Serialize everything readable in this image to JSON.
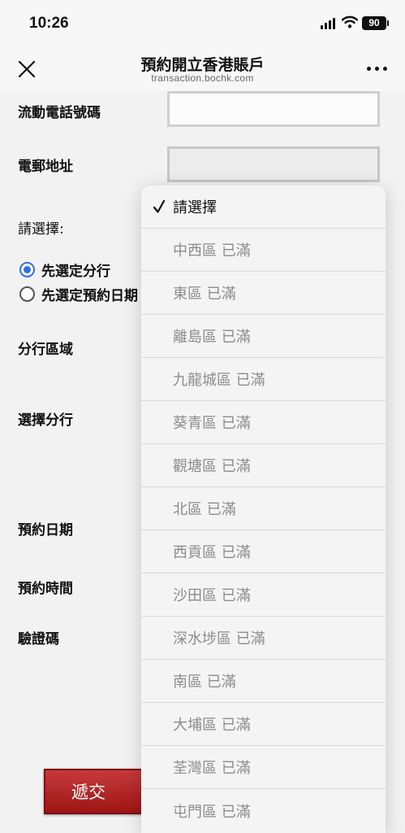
{
  "status": {
    "time": "10:26",
    "battery": "90"
  },
  "nav": {
    "title": "預約開立香港賬戶",
    "subtitle": "transaction.bochk.com"
  },
  "form": {
    "mobile_label": "流動電話號碼",
    "email_label": "電郵地址",
    "choose_label": "請選擇:",
    "radio_branch_first": "先選定分行",
    "radio_date_first": "先選定預約日期",
    "district_label": "分行區域",
    "branch_label": "選擇分行",
    "date_label": "預約日期",
    "time_label": "預約時間",
    "captcha_label": "驗證碼",
    "submit_label": "遞交"
  },
  "dropdown": {
    "selected": "請選擇",
    "options": [
      "請選擇",
      "中西區 已滿",
      "東區 已滿",
      "離島區 已滿",
      "九龍城區 已滿",
      "葵青區 已滿",
      "觀塘區 已滿",
      "北區 已滿",
      "西貢區 已滿",
      "沙田區 已滿",
      "深水埗區 已滿",
      "南區 已滿",
      "大埔區 已滿",
      "荃灣區 已滿",
      "屯門區 已滿"
    ]
  }
}
